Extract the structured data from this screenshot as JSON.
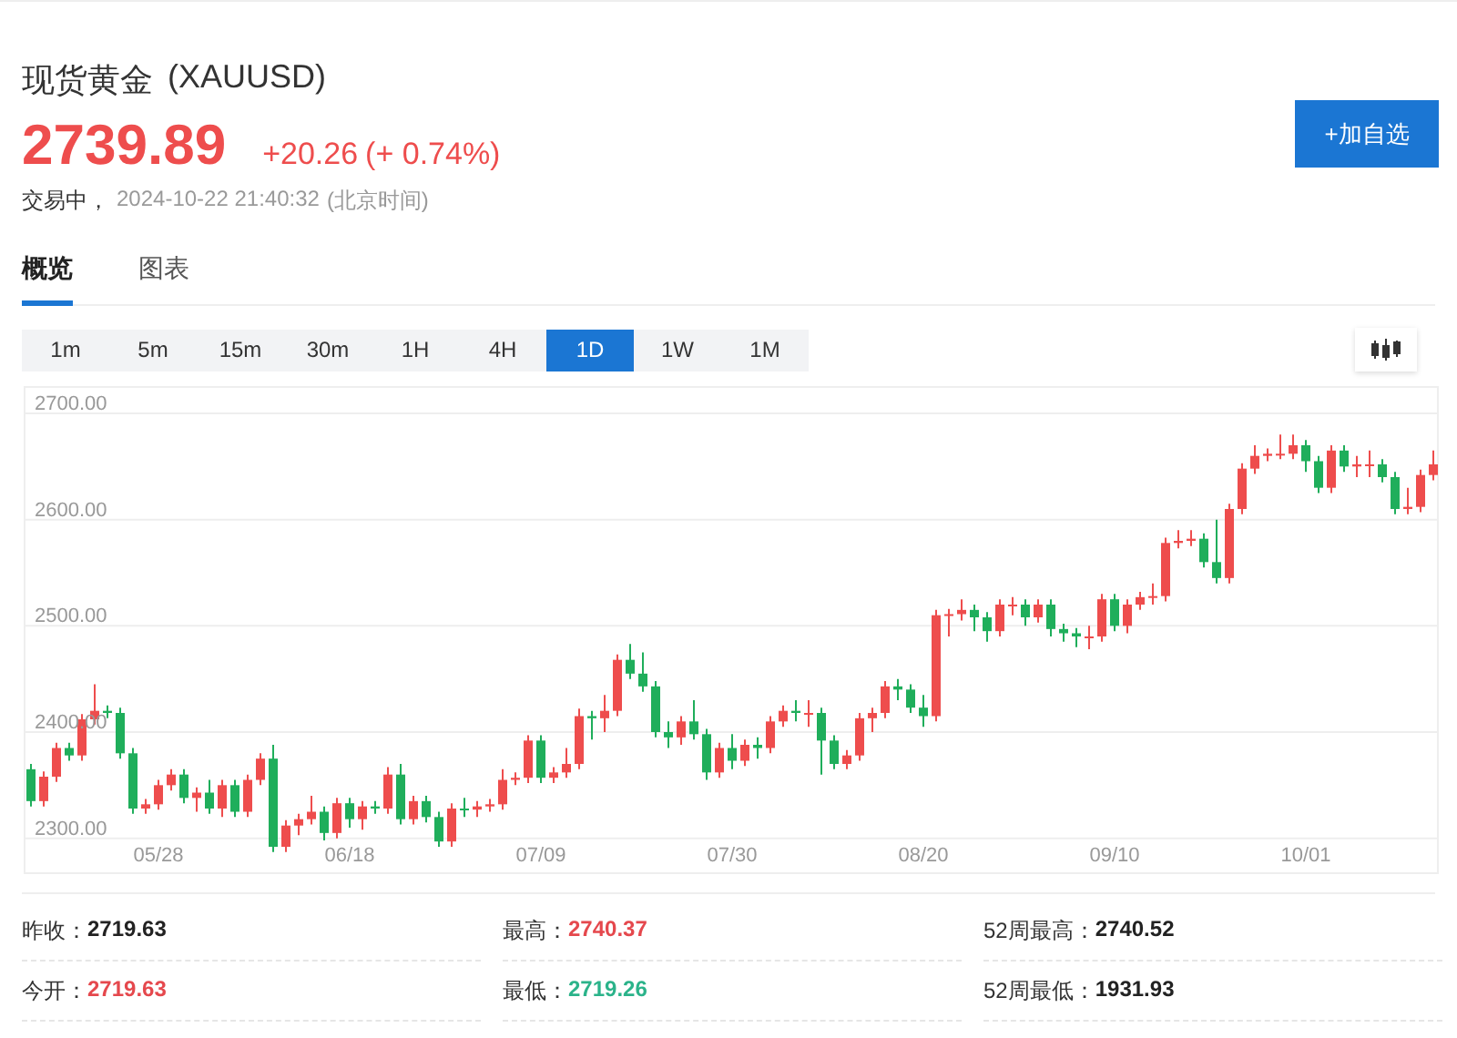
{
  "header": {
    "name": "现货黄金",
    "symbol": "(XAUUSD)",
    "price": "2739.89",
    "change": "+20.26",
    "change_pct": "(+ 0.74%)",
    "status": "交易中，",
    "time": "2024-10-22 21:40:32",
    "timezone": "(北京时间)",
    "watch_button": "+加自选"
  },
  "tabs": [
    {
      "label": "概览",
      "selected": true
    },
    {
      "label": "图表",
      "selected": false
    }
  ],
  "periods": [
    {
      "label": "1m",
      "selected": false
    },
    {
      "label": "5m",
      "selected": false
    },
    {
      "label": "15m",
      "selected": false
    },
    {
      "label": "30m",
      "selected": false
    },
    {
      "label": "1H",
      "selected": false
    },
    {
      "label": "4H",
      "selected": false
    },
    {
      "label": "1D",
      "selected": true
    },
    {
      "label": "1W",
      "selected": false
    },
    {
      "label": "1M",
      "selected": false
    }
  ],
  "chart": {
    "chart_data": {
      "type": "candlestick",
      "categories": [
        null,
        null,
        null,
        null,
        null,
        null,
        null,
        null,
        null,
        null,
        "05/28",
        null,
        null,
        null,
        null,
        null,
        null,
        null,
        null,
        null,
        null,
        null,
        null,
        null,
        null,
        "06/18",
        null,
        null,
        null,
        null,
        null,
        null,
        null,
        null,
        null,
        null,
        null,
        null,
        null,
        null,
        "07/09",
        null,
        null,
        null,
        null,
        null,
        null,
        null,
        null,
        null,
        null,
        null,
        null,
        null,
        null,
        "07/30",
        null,
        null,
        null,
        null,
        null,
        null,
        null,
        null,
        null,
        null,
        null,
        null,
        null,
        null,
        "08/20",
        null,
        null,
        null,
        null,
        null,
        null,
        null,
        null,
        null,
        null,
        null,
        null,
        null,
        null,
        "09/10",
        null,
        null,
        null,
        null,
        null,
        null,
        null,
        null,
        null,
        null,
        null,
        null,
        null,
        null,
        "10/01",
        null,
        null,
        null,
        null,
        null,
        null,
        null,
        null,
        null,
        null
      ],
      "ohlc": [
        [
          2365,
          2370,
          2330,
          2335
        ],
        [
          2335,
          2363,
          2330,
          2358
        ],
        [
          2358,
          2390,
          2353,
          2385
        ],
        [
          2385,
          2390,
          2373,
          2378
        ],
        [
          2378,
          2417,
          2373,
          2412
        ],
        [
          2412,
          2445,
          2407,
          2420
        ],
        [
          2420,
          2425,
          2413,
          2418
        ],
        [
          2418,
          2423,
          2375,
          2380
        ],
        [
          2380,
          2385,
          2323,
          2328
        ],
        [
          2328,
          2337,
          2323,
          2332
        ],
        [
          2332,
          2355,
          2327,
          2350
        ],
        [
          2350,
          2365,
          2345,
          2360
        ],
        [
          2360,
          2365,
          2333,
          2338
        ],
        [
          2338,
          2348,
          2325,
          2343
        ],
        [
          2343,
          2355,
          2323,
          2328
        ],
        [
          2328,
          2355,
          2320,
          2350
        ],
        [
          2350,
          2355,
          2320,
          2325
        ],
        [
          2325,
          2360,
          2320,
          2355
        ],
        [
          2355,
          2380,
          2350,
          2375
        ],
        [
          2375,
          2388,
          2287,
          2292
        ],
        [
          2292,
          2317,
          2287,
          2312
        ],
        [
          2312,
          2323,
          2303,
          2318
        ],
        [
          2318,
          2340,
          2313,
          2325
        ],
        [
          2325,
          2330,
          2298,
          2305
        ],
        [
          2305,
          2338,
          2300,
          2333
        ],
        [
          2333,
          2338,
          2310,
          2318
        ],
        [
          2318,
          2335,
          2308,
          2330
        ],
        [
          2330,
          2335,
          2323,
          2328
        ],
        [
          2328,
          2367,
          2323,
          2360
        ],
        [
          2360,
          2370,
          2313,
          2318
        ],
        [
          2318,
          2340,
          2313,
          2335
        ],
        [
          2335,
          2340,
          2315,
          2320
        ],
        [
          2320,
          2325,
          2292,
          2297
        ],
        [
          2297,
          2333,
          2292,
          2328
        ],
        [
          2328,
          2338,
          2320,
          2327
        ],
        [
          2327,
          2335,
          2320,
          2330
        ],
        [
          2330,
          2337,
          2325,
          2332
        ],
        [
          2332,
          2365,
          2327,
          2355
        ],
        [
          2355,
          2362,
          2350,
          2357
        ],
        [
          2357,
          2397,
          2352,
          2392
        ],
        [
          2392,
          2397,
          2352,
          2357
        ],
        [
          2357,
          2367,
          2352,
          2362
        ],
        [
          2362,
          2385,
          2357,
          2370
        ],
        [
          2370,
          2422,
          2365,
          2415
        ],
        [
          2415,
          2420,
          2393,
          2413
        ],
        [
          2413,
          2435,
          2400,
          2420
        ],
        [
          2420,
          2473,
          2415,
          2468
        ],
        [
          2468,
          2483,
          2450,
          2455
        ],
        [
          2455,
          2475,
          2438,
          2443
        ],
        [
          2443,
          2448,
          2395,
          2400
        ],
        [
          2400,
          2410,
          2385,
          2395
        ],
        [
          2395,
          2415,
          2388,
          2410
        ],
        [
          2410,
          2430,
          2393,
          2398
        ],
        [
          2398,
          2403,
          2355,
          2362
        ],
        [
          2362,
          2390,
          2357,
          2385
        ],
        [
          2385,
          2398,
          2365,
          2373
        ],
        [
          2373,
          2393,
          2368,
          2388
        ],
        [
          2388,
          2395,
          2375,
          2385
        ],
        [
          2385,
          2415,
          2380,
          2410
        ],
        [
          2410,
          2425,
          2405,
          2420
        ],
        [
          2420,
          2430,
          2410,
          2418
        ],
        [
          2418,
          2430,
          2405,
          2418
        ],
        [
          2418,
          2423,
          2360,
          2392
        ],
        [
          2392,
          2397,
          2365,
          2370
        ],
        [
          2370,
          2383,
          2365,
          2378
        ],
        [
          2378,
          2418,
          2373,
          2413
        ],
        [
          2413,
          2423,
          2400,
          2418
        ],
        [
          2418,
          2448,
          2413,
          2443
        ],
        [
          2443,
          2450,
          2430,
          2440
        ],
        [
          2440,
          2445,
          2418,
          2423
        ],
        [
          2423,
          2435,
          2405,
          2415
        ],
        [
          2415,
          2515,
          2410,
          2510
        ],
        [
          2510,
          2516,
          2490,
          2511
        ],
        [
          2511,
          2525,
          2505,
          2515
        ],
        [
          2515,
          2520,
          2495,
          2508
        ],
        [
          2508,
          2513,
          2485,
          2495
        ],
        [
          2495,
          2525,
          2490,
          2520
        ],
        [
          2520,
          2527,
          2510,
          2520
        ],
        [
          2520,
          2525,
          2500,
          2508
        ],
        [
          2508,
          2525,
          2503,
          2520
        ],
        [
          2520,
          2525,
          2490,
          2497
        ],
        [
          2497,
          2502,
          2485,
          2493
        ],
        [
          2493,
          2498,
          2480,
          2490
        ],
        [
          2490,
          2500,
          2478,
          2490
        ],
        [
          2490,
          2530,
          2485,
          2525
        ],
        [
          2525,
          2530,
          2495,
          2500
        ],
        [
          2500,
          2525,
          2493,
          2520
        ],
        [
          2520,
          2532,
          2515,
          2527
        ],
        [
          2527,
          2540,
          2520,
          2528
        ],
        [
          2528,
          2583,
          2523,
          2578
        ],
        [
          2578,
          2590,
          2573,
          2580
        ],
        [
          2580,
          2590,
          2575,
          2582
        ],
        [
          2582,
          2587,
          2555,
          2560
        ],
        [
          2560,
          2600,
          2540,
          2545
        ],
        [
          2545,
          2615,
          2540,
          2610
        ],
        [
          2610,
          2653,
          2605,
          2648
        ],
        [
          2648,
          2670,
          2643,
          2660
        ],
        [
          2660,
          2667,
          2655,
          2662
        ],
        [
          2662,
          2680,
          2657,
          2662
        ],
        [
          2662,
          2680,
          2657,
          2670
        ],
        [
          2670,
          2675,
          2645,
          2655
        ],
        [
          2655,
          2660,
          2625,
          2630
        ],
        [
          2630,
          2670,
          2625,
          2665
        ],
        [
          2665,
          2670,
          2645,
          2650
        ],
        [
          2650,
          2660,
          2640,
          2652
        ],
        [
          2652,
          2665,
          2640,
          2652
        ],
        [
          2652,
          2657,
          2635,
          2640
        ],
        [
          2640,
          2645,
          2605,
          2610
        ],
        [
          2610,
          2630,
          2605,
          2612
        ],
        [
          2612,
          2647,
          2607,
          2642
        ],
        [
          2642,
          2665,
          2637,
          2652
        ]
      ],
      "ylim": [
        2268,
        2724
      ],
      "grid": true,
      "yticks": [
        {
          "value": 2300,
          "label": "2300.00"
        },
        {
          "value": 2400,
          "label": "2400.00"
        },
        {
          "value": 2500,
          "label": "2500.00"
        },
        {
          "value": 2600,
          "label": "2600.00"
        },
        {
          "value": 2700,
          "label": "2700.00"
        }
      ]
    }
  },
  "stats": [
    {
      "label": "昨收：",
      "value": "2719.63",
      "color": "#222222"
    },
    {
      "label": "最高：",
      "value": "2740.37",
      "color": "#e5484d"
    },
    {
      "label": "52周最高：",
      "value": "2740.52",
      "color": "#222222"
    },
    {
      "label": "今开：",
      "value": "2719.63",
      "color": "#e5484d"
    },
    {
      "label": "最低：",
      "value": "2719.26",
      "color": "#2bb38a"
    },
    {
      "label": "52周最低：",
      "value": "1931.93",
      "color": "#222222"
    }
  ]
}
